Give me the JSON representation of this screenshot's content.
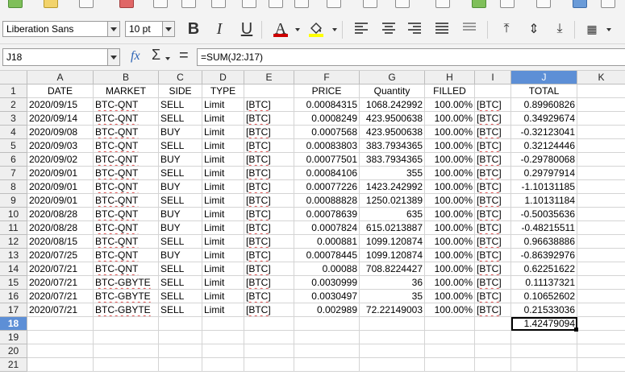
{
  "toolbar": {
    "font_name": "Liberation Sans",
    "font_size": "10 pt",
    "bold_label": "B",
    "italic_label": "I",
    "underline_label": "U",
    "font_color_label": "A",
    "font_color": "#cc0000",
    "highlight_color": "#ffff00"
  },
  "formula_bar": {
    "cell_ref": "J18",
    "fx_label": "fx",
    "sigma_label": "Σ",
    "equals_label": "=",
    "formula": "=SUM(J2:J17)"
  },
  "sheet": {
    "columns": [
      "A",
      "B",
      "C",
      "D",
      "E",
      "F",
      "G",
      "H",
      "I",
      "J",
      "K"
    ],
    "row_numbers": [
      "1",
      "2",
      "3",
      "4",
      "5",
      "6",
      "7",
      "8",
      "9",
      "10",
      "11",
      "12",
      "13",
      "14",
      "15",
      "16",
      "17",
      "18",
      "19",
      "20",
      "21"
    ],
    "selected_column": "J",
    "selected_row": "18",
    "headers": [
      "DATE",
      "MARKET",
      "SIDE",
      "TYPE",
      "",
      "PRICE",
      "Quantity",
      "FILLED",
      "",
      "TOTAL"
    ],
    "rows": [
      [
        "2020/09/15",
        "BTC-QNT",
        "SELL",
        "Limit",
        "[BTC]",
        "0.00084315",
        "1068.242992",
        "100.00%",
        "[BTC]",
        "0.89960826"
      ],
      [
        "2020/09/14",
        "BTC-QNT",
        "SELL",
        "Limit",
        "[BTC]",
        "0.0008249",
        "423.9500638",
        "100.00%",
        "[BTC]",
        "0.34929674"
      ],
      [
        "2020/09/08",
        "BTC-QNT",
        "BUY",
        "Limit",
        "[BTC]",
        "0.0007568",
        "423.9500638",
        "100.00%",
        "[BTC]",
        "-0.32123041"
      ],
      [
        "2020/09/03",
        "BTC-QNT",
        "SELL",
        "Limit",
        "[BTC]",
        "0.00083803",
        "383.7934365",
        "100.00%",
        "[BTC]",
        "0.32124446"
      ],
      [
        "2020/09/02",
        "BTC-QNT",
        "BUY",
        "Limit",
        "[BTC]",
        "0.00077501",
        "383.7934365",
        "100.00%",
        "[BTC]",
        "-0.29780068"
      ],
      [
        "2020/09/01",
        "BTC-QNT",
        "SELL",
        "Limit",
        "[BTC]",
        "0.00084106",
        "355",
        "100.00%",
        "[BTC]",
        "0.29797914"
      ],
      [
        "2020/09/01",
        "BTC-QNT",
        "BUY",
        "Limit",
        "[BTC]",
        "0.00077226",
        "1423.242992",
        "100.00%",
        "[BTC]",
        "-1.10131185"
      ],
      [
        "2020/09/01",
        "BTC-QNT",
        "SELL",
        "Limit",
        "[BTC]",
        "0.00088828",
        "1250.021389",
        "100.00%",
        "[BTC]",
        "1.10131184"
      ],
      [
        "2020/08/28",
        "BTC-QNT",
        "BUY",
        "Limit",
        "[BTC]",
        "0.00078639",
        "635",
        "100.00%",
        "[BTC]",
        "-0.50035636"
      ],
      [
        "2020/08/28",
        "BTC-QNT",
        "BUY",
        "Limit",
        "[BTC]",
        "0.0007824",
        "615.0213887",
        "100.00%",
        "[BTC]",
        "-0.48215511"
      ],
      [
        "2020/08/15",
        "BTC-QNT",
        "SELL",
        "Limit",
        "[BTC]",
        "0.000881",
        "1099.120874",
        "100.00%",
        "[BTC]",
        "0.96638886"
      ],
      [
        "2020/07/25",
        "BTC-QNT",
        "BUY",
        "Limit",
        "[BTC]",
        "0.00078445",
        "1099.120874",
        "100.00%",
        "[BTC]",
        "-0.86392976"
      ],
      [
        "2020/07/21",
        "BTC-QNT",
        "SELL",
        "Limit",
        "[BTC]",
        "0.00088",
        "708.8224427",
        "100.00%",
        "[BTC]",
        "0.62251622"
      ],
      [
        "2020/07/21",
        "BTC-GBYTE",
        "SELL",
        "Limit",
        "[BTC]",
        "0.0030999",
        "36",
        "100.00%",
        "[BTC]",
        "0.11137321"
      ],
      [
        "2020/07/21",
        "BTC-GBYTE",
        "SELL",
        "Limit",
        "[BTC]",
        "0.0030497",
        "35",
        "100.00%",
        "[BTC]",
        "0.10652602"
      ],
      [
        "2020/07/21",
        "BTC-GBYTE",
        "SELL",
        "Limit",
        "[BTC]",
        "0.002989",
        "72.22149003",
        "100.00%",
        "[BTC]",
        "0.21533036"
      ]
    ],
    "total_row": [
      "",
      "",
      "",
      "",
      "",
      "",
      "",
      "",
      "",
      "1.42479094"
    ]
  }
}
